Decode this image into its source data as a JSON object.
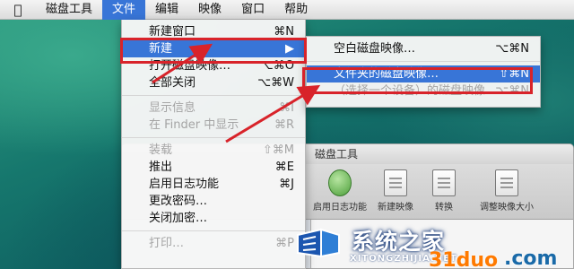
{
  "menubar": {
    "apple_icon": "apple-icon",
    "items": [
      {
        "label": "磁盘工具"
      },
      {
        "label": "文件",
        "active": true
      },
      {
        "label": "编辑"
      },
      {
        "label": "映像"
      },
      {
        "label": "窗口"
      },
      {
        "label": "帮助"
      }
    ]
  },
  "file_menu": {
    "items": [
      {
        "label": "新建窗口",
        "shortcut": "⌘N",
        "state": "normal"
      },
      {
        "label": "新建",
        "shortcut": "▶",
        "state": "highlight"
      },
      {
        "label": "打开磁盘映像…",
        "shortcut": "⌥⌘O",
        "state": "normal"
      },
      {
        "label": "全部关闭",
        "shortcut": "⌥⌘W",
        "state": "normal"
      },
      {
        "label": "显示信息",
        "shortcut": "⌘I",
        "state": "disabled"
      },
      {
        "label": "在 Finder 中显示",
        "shortcut": "⌘R",
        "state": "disabled"
      },
      {
        "label": "装载",
        "shortcut": "⇧⌘M",
        "state": "disabled"
      },
      {
        "label": "推出",
        "shortcut": "⌘E",
        "state": "normal"
      },
      {
        "label": "启用日志功能",
        "shortcut": "⌘J",
        "state": "normal"
      },
      {
        "label": "更改密码…",
        "shortcut": "",
        "state": "normal"
      },
      {
        "label": "关闭加密…",
        "shortcut": "",
        "state": "normal"
      },
      {
        "label": "打印…",
        "shortcut": "⌘P",
        "state": "disabled"
      }
    ]
  },
  "new_submenu": {
    "items": [
      {
        "label": "空白磁盘映像…",
        "shortcut": "⌥⌘N",
        "state": "normal"
      },
      {
        "label": "文件夹的磁盘映像…",
        "shortcut": "⇧⌘N",
        "state": "highlight"
      },
      {
        "label": "（选择一个设备）的磁盘映像…",
        "shortcut": "⌥⌘N",
        "state": "disabled"
      }
    ]
  },
  "window": {
    "title": "磁盘工具",
    "toolbar": [
      {
        "label": "启用日志功能",
        "icon": "green-ball-icon"
      },
      {
        "label": "新建映像",
        "icon": "new-image-icon"
      },
      {
        "label": "转换",
        "icon": "convert-icon"
      },
      {
        "label": "调整映像大小",
        "icon": "resize-image-icon"
      }
    ]
  },
  "watermark": {
    "brand_cn": "系统之家",
    "brand_en": "XITONGZHIJIA.NET",
    "site_a": "31duo",
    "site_b": ".com"
  },
  "colors": {
    "highlight": "#3875d7",
    "callout": "#d8232a"
  }
}
